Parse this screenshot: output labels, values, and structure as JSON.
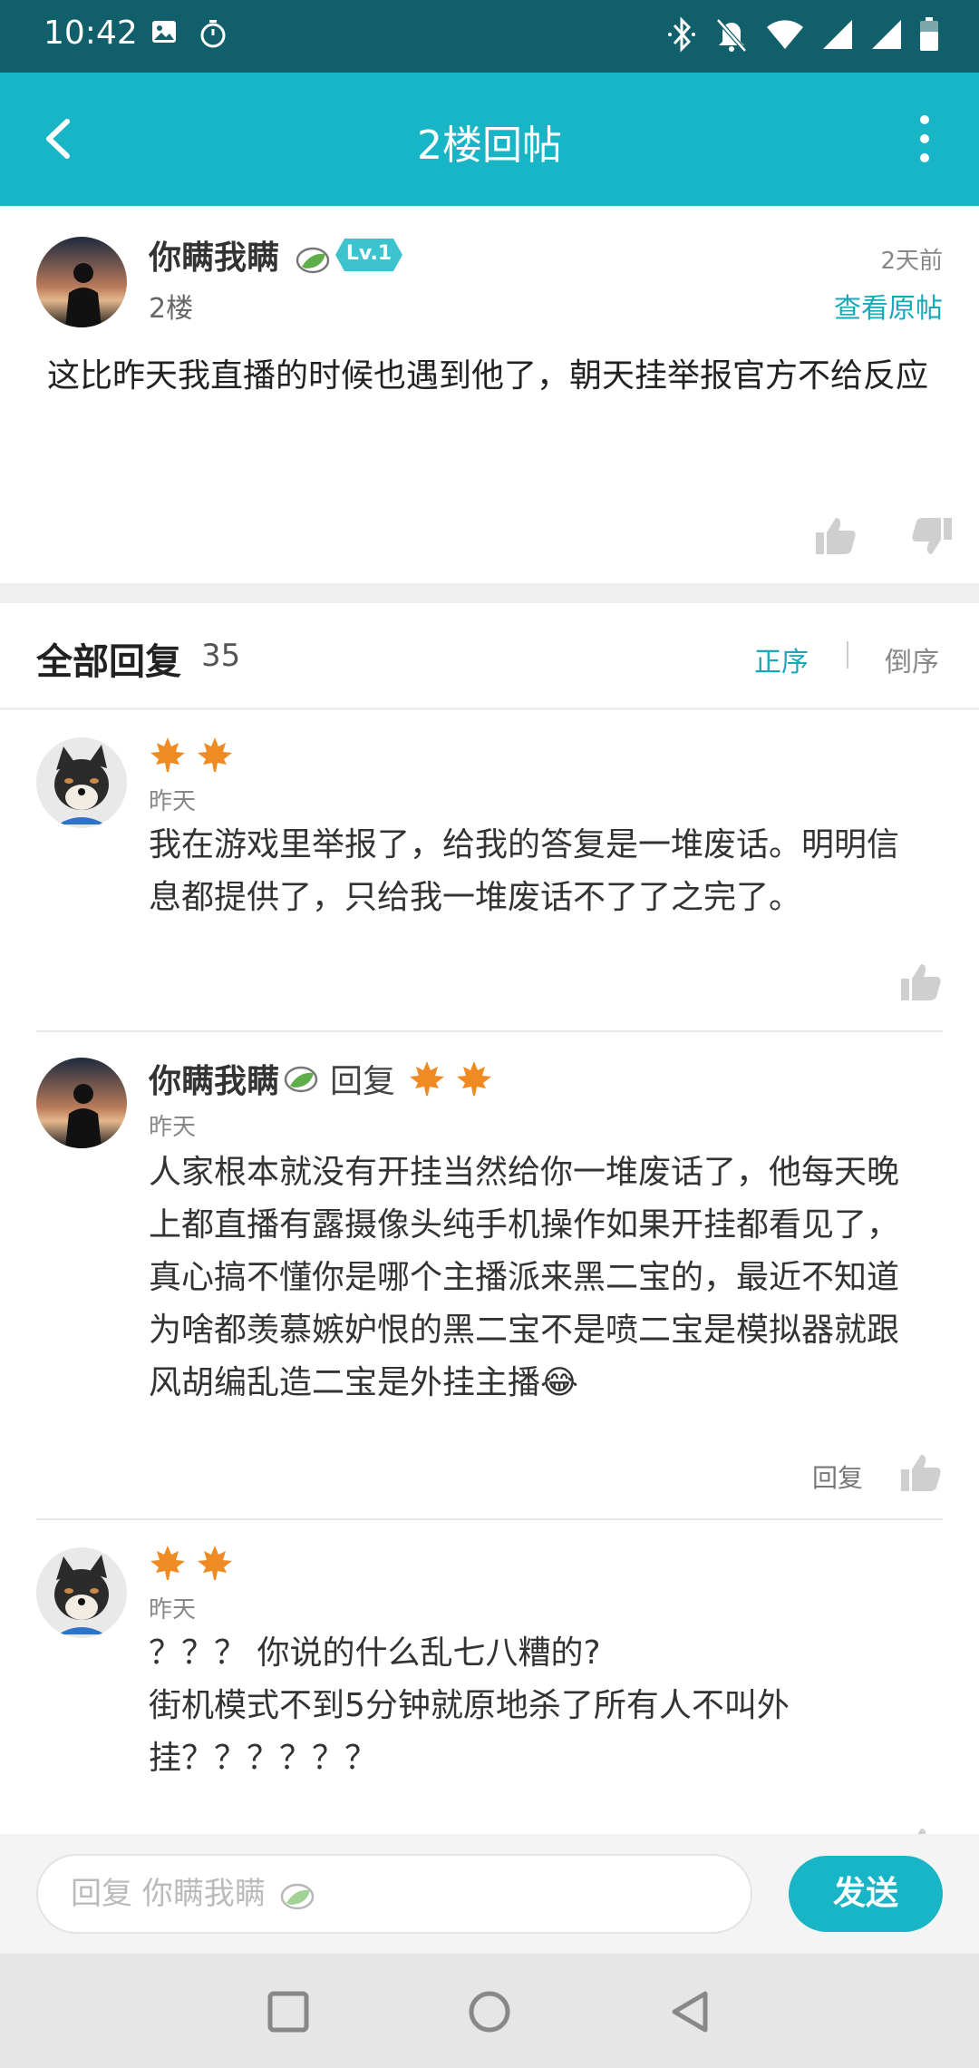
{
  "status_bar": {
    "time": "10:42",
    "left_icons": [
      "image-icon",
      "timer-icon"
    ],
    "right_icons": [
      "bluetooth-icon",
      "bell-off-icon",
      "wifi-icon",
      "signal-icon",
      "signal-icon",
      "battery-icon"
    ]
  },
  "header": {
    "title": "2楼回帖"
  },
  "post": {
    "username": "你瞒我瞒",
    "level": "Lv.1",
    "floor": "2楼",
    "time": "2天前",
    "view_original": "查看原帖",
    "body": "这比昨天我直播的时候也遇到他了，朝天挂举报官方不给反应"
  },
  "replies_header": {
    "title": "全部回复",
    "count": "35",
    "sort_asc": "正序",
    "sort_desc": "倒序"
  },
  "replies": [
    {
      "time": "昨天",
      "body": "我在游戏里举报了，给我的答复是一堆废话。明明信息都提供了，只给我一堆废话不了了之完了。"
    },
    {
      "username": "你瞒我瞒",
      "reply_word": "回复",
      "time": "昨天",
      "body": "人家根本就没有开挂当然给你一堆废话了，他每天晚上都直播有露摄像头纯手机操作如果开挂都看见了，真心搞不懂你是哪个主播派来黑二宝的，最近不知道为啥都羡慕嫉妒恨的黑二宝不是喷二宝是模拟器就跟风胡编乱造二宝是外挂主播😂",
      "reply_button": "回复"
    },
    {
      "time": "昨天",
      "body_line1": "？？？ 你说的什么乱七八糟的?",
      "body_line2": "街机模式不到5分钟就原地杀了所有人不叫外挂？？？？？？"
    }
  ],
  "input_bar": {
    "placeholder": "回复 你瞒我瞒",
    "send_label": "发送"
  },
  "colors": {
    "status_bar": "#115f6b",
    "header": "#18b5c6",
    "accent": "#18a8b8"
  }
}
